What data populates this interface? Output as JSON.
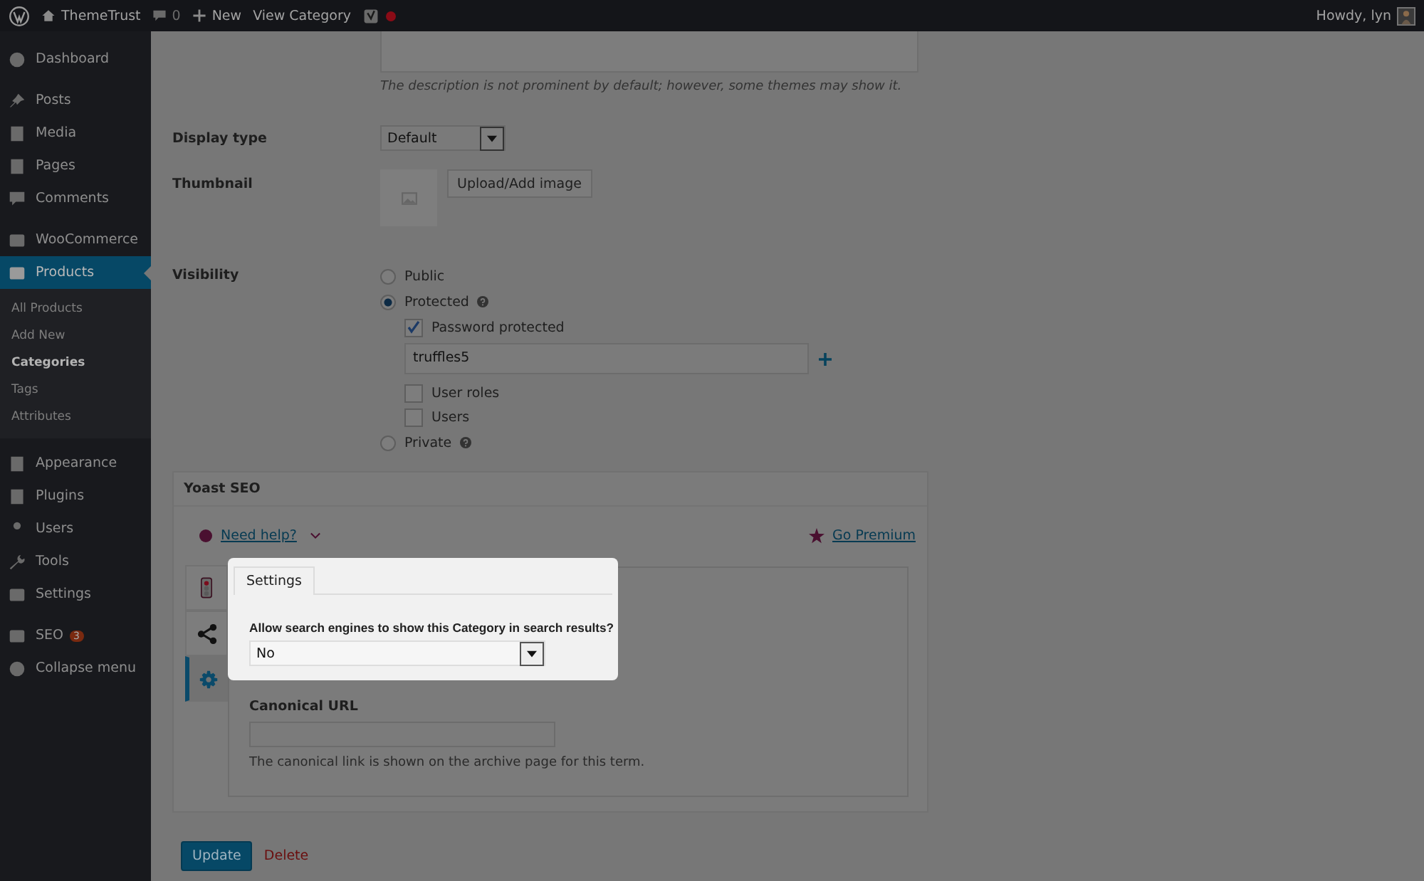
{
  "admin_bar": {
    "site": "ThemeTrust",
    "comments": "0",
    "new": "New",
    "view": "View Category",
    "notification": true,
    "account": "Howdy, lyn"
  },
  "sidebar": {
    "items": [
      {
        "label": "Dashboard",
        "kind": "dashboard",
        "selected": false
      },
      {
        "label": "Posts",
        "kind": "pin",
        "selected": false
      },
      {
        "label": "Media",
        "kind": "media",
        "selected": false
      },
      {
        "label": "Pages",
        "kind": "pages",
        "selected": false
      },
      {
        "label": "Comments",
        "kind": "comment",
        "selected": false
      },
      {
        "label": "WooCommerce",
        "kind": "woo",
        "selected": false
      },
      {
        "label": "Products",
        "kind": "box",
        "selected": true,
        "children": [
          {
            "label": "All Products",
            "selected": false
          },
          {
            "label": "Add New",
            "selected": false
          },
          {
            "label": "Categories",
            "selected": true
          },
          {
            "label": "Tags",
            "selected": false
          },
          {
            "label": "Attributes",
            "selected": false
          }
        ]
      },
      {
        "label": "Appearance",
        "kind": "brush",
        "selected": false
      },
      {
        "label": "Plugins",
        "kind": "plug",
        "selected": false
      },
      {
        "label": "Users",
        "kind": "user",
        "selected": false
      },
      {
        "label": "Tools",
        "kind": "wrench",
        "selected": false
      },
      {
        "label": "Settings",
        "kind": "settings",
        "selected": false
      },
      {
        "label": "SEO",
        "kind": "yoast",
        "selected": false,
        "badge": "3"
      },
      {
        "label": "Collapse menu",
        "kind": "collapse",
        "selected": false
      }
    ]
  },
  "form": {
    "description_help": "The description is not prominent by default; however, some themes may show it.",
    "display_type": {
      "label": "Display type",
      "value": "Default"
    },
    "thumbnail": {
      "label": "Thumbnail",
      "button": "Upload/Add image"
    },
    "visibility": {
      "label": "Visibility",
      "options": [
        {
          "label": "Public",
          "selected": false,
          "help": false
        },
        {
          "label": "Protected",
          "selected": true,
          "help": true,
          "details": {
            "password": {
              "label": "Password protected",
              "checked": true,
              "value": "truffles5"
            },
            "checks": [
              {
                "label": "User roles",
                "checked": false
              },
              {
                "label": "Users",
                "checked": false
              }
            ]
          }
        },
        {
          "label": "Private",
          "selected": false,
          "help": true
        }
      ]
    }
  },
  "yoast": {
    "title": "Yoast SEO",
    "help_link": "Need help?",
    "premium_link": "Go Premium",
    "side_tabs": [
      {
        "kind": "traffic-light",
        "selected": false
      },
      {
        "kind": "share",
        "selected": false
      },
      {
        "kind": "gear",
        "selected": true
      }
    ],
    "highlight": {
      "tab": "Settings",
      "question": "Allow search engines to show this Category in search results?",
      "value": "No"
    },
    "canonical": {
      "label": "Canonical URL",
      "help": "The canonical link is shown on the archive page for this term."
    }
  },
  "actions": {
    "update": "Update",
    "delete": "Delete"
  }
}
